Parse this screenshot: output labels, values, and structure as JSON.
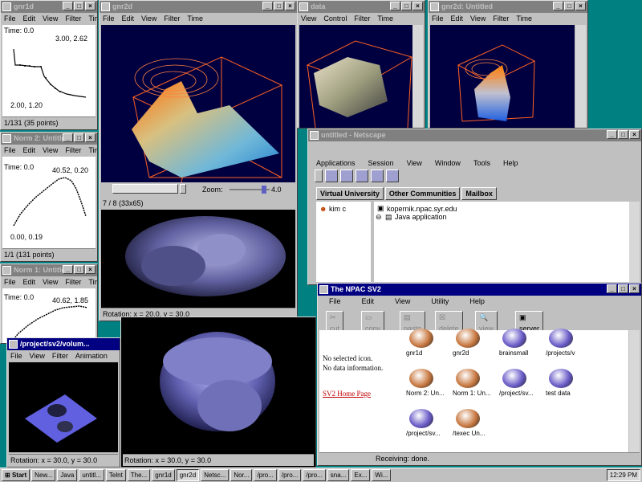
{
  "gnr1d": {
    "title": "gnr1d",
    "menu": [
      "File",
      "Edit",
      "View",
      "Filter",
      "Time"
    ],
    "time": "Time: 0.0",
    "max": "3.00, 2.62",
    "min": "2.00, 1.20",
    "status": "1/131 (35 points)"
  },
  "norm2": {
    "title": "Norm 2: Untitled",
    "menu": [
      "File",
      "Edit",
      "View",
      "Filter",
      "Time"
    ],
    "time": "Time: 0.0",
    "max": "40.52, 0.20",
    "min": "0.00, 0.19",
    "status": "1/1 (131 points)"
  },
  "norm1": {
    "title": "Norm 1: Untitled",
    "menu": [
      "File",
      "Edit",
      "View",
      "Filter",
      "Time"
    ],
    "time": "Time: 0.0",
    "max": "40.62, 1.85"
  },
  "gnr2d": {
    "title": "gnr2d",
    "menu": [
      "File",
      "Edit",
      "View",
      "Filter",
      "Time"
    ],
    "zoom": "Zoom:",
    "zoom_val": "4.0",
    "status": "7 / 8 (33x65)",
    "rotation": "Rotation: x = 20.0, y = 30.0"
  },
  "data": {
    "title": "data",
    "menu": [
      "View",
      "Control",
      "Filter",
      "Time"
    ]
  },
  "nnpac": {
    "title": "gnr2d: Untitled",
    "menu": [
      "File",
      "Edit",
      "View",
      "Filter",
      "Time"
    ]
  },
  "netscape": {
    "title": "untitled - Netscape",
    "menu": [
      "Applications",
      "Session",
      "View",
      "Window",
      "Tools",
      "Help"
    ],
    "tabs": [
      "Virtual University",
      "Other Communities",
      "Mailbox"
    ],
    "tree_user": "kim c",
    "tree_host": "kopernik.npac.syr.edu",
    "tree_app": "Java application"
  },
  "sv2": {
    "title": "The NPAC SV2",
    "menu": [
      "File",
      "Edit",
      "View",
      "Utility",
      "Help"
    ],
    "toolbar": [
      "cut",
      "copy",
      "paste",
      "delete",
      "view",
      "server"
    ],
    "no_icon": "No selected icon.",
    "no_data": "No data information.",
    "home_link": "SV2 Home Page",
    "icons": [
      {
        "label": "gnr1d",
        "color": "#c87840"
      },
      {
        "label": "gnr2d",
        "color": "#c87840"
      },
      {
        "label": "brainsmall",
        "color": "#6a5cc8"
      },
      {
        "label": "/projects/v",
        "color": "#6a5cc8"
      },
      {
        "label": "Norm 2: Un...",
        "color": "#c87840"
      },
      {
        "label": "Norm 1: Un...",
        "color": "#c87840"
      },
      {
        "label": "/project/sv...",
        "color": "#6a5cc8"
      },
      {
        "label": "test data",
        "color": "#6a5cc8"
      },
      {
        "label": "/project/sv...",
        "color": "#6a5cc8"
      },
      {
        "label": "/texec Un...",
        "color": "#c87840"
      }
    ],
    "status": "Receiving: done."
  },
  "volume": {
    "title": "/project/sv2/volum...",
    "menu": [
      "File",
      "View",
      "Filter",
      "Animation"
    ],
    "rotation": "Rotation: x = 30.0, y = 30.0"
  },
  "head": {
    "rotation": "Rotation: x = 30.0, y = 30.0"
  },
  "taskbar": {
    "start": "Start",
    "buttons": [
      "New...",
      "Java",
      "untitl...",
      "Telnt",
      "The...",
      "gnr1d",
      "gnr2d",
      "Netsc...",
      "Nor...",
      "/pro...",
      "/pro...",
      "/pro...",
      "sna...",
      "Ex...",
      "Wi..."
    ],
    "clock": "12:29 PM"
  }
}
